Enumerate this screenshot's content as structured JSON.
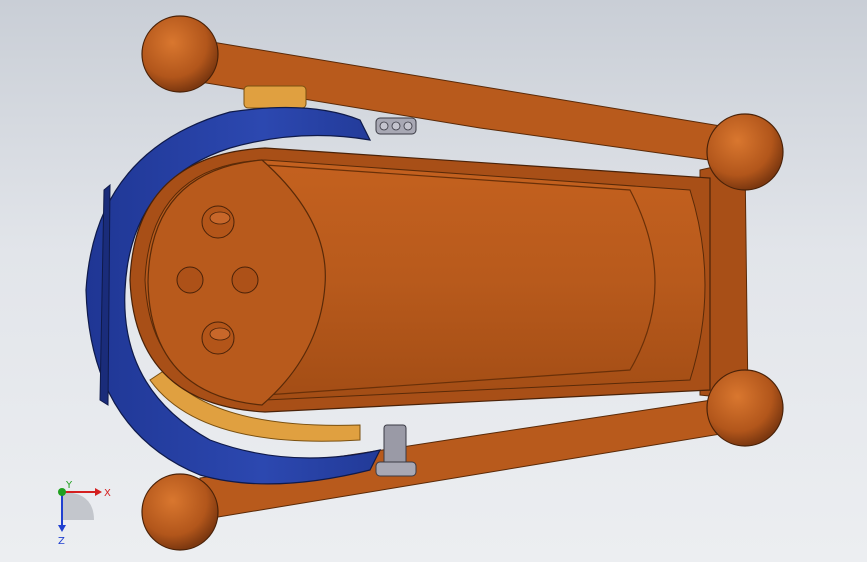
{
  "viewport": {
    "background_top": "#c9ced6",
    "background_bottom": "#eceef1"
  },
  "model": {
    "body_color": "#b85a1c",
    "body_shadow": "#8e3f0f",
    "body_highlight": "#d0702e",
    "band_color": "#2a44a8",
    "band_shadow": "#1a2c7a",
    "bearing_color": "#e0a040",
    "bolt_color": "#9a9aa6"
  },
  "triad": {
    "x_label": "X",
    "y_label": "Y",
    "z_label": "Z",
    "x_color": "#d42020",
    "y_color": "#20a020",
    "z_color": "#2040d0"
  }
}
